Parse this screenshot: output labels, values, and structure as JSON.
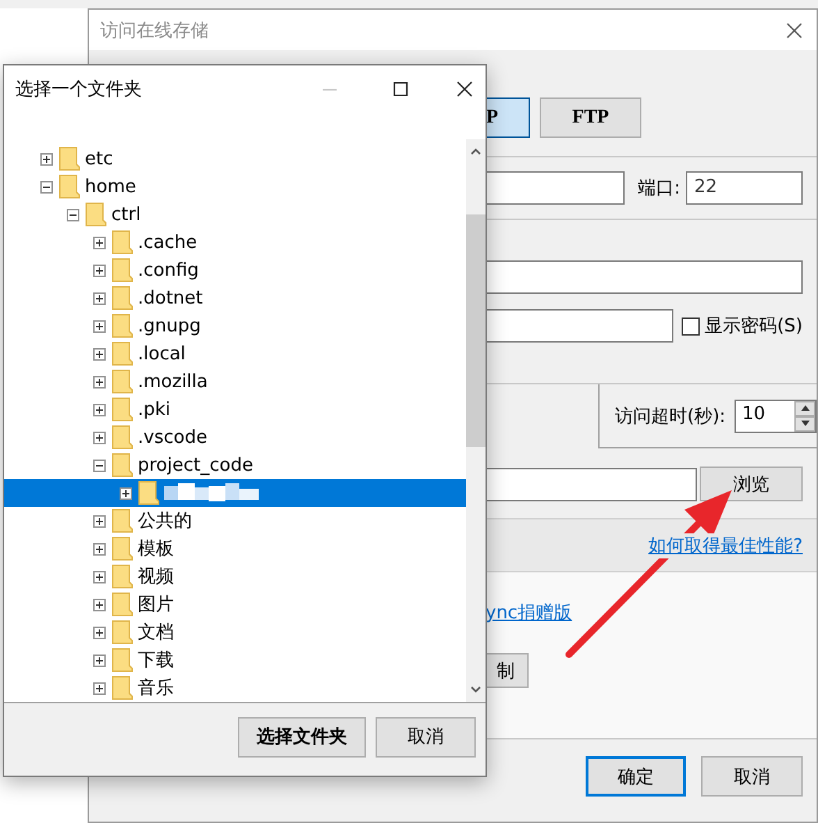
{
  "main_dialog": {
    "title": "访问在线存储",
    "protocols": [
      {
        "label": "P",
        "selected": true
      },
      {
        "label": "FTP",
        "selected": false
      }
    ],
    "port_label": "端口:",
    "port": "22",
    "show_password": {
      "label": "显示密码(S)",
      "checked": false
    },
    "timeout_label": "访问超时(秒):",
    "timeout": "10",
    "browse_button": "浏览",
    "performance_link": "如何取得最佳性能?",
    "donate_link": "ync捐赠版",
    "limit_button": "制",
    "ok_button": "确定",
    "cancel_button": "取消"
  },
  "folder_dialog": {
    "title": "选择一个文件夹",
    "tree": [
      {
        "label": "etc",
        "expanded": false,
        "selected": false
      },
      {
        "label": "home",
        "expanded": true,
        "selected": false,
        "children": [
          {
            "label": "ctrl",
            "expanded": true,
            "selected": false,
            "children": [
              {
                "label": ".cache",
                "expanded": false,
                "selected": false
              },
              {
                "label": ".config",
                "expanded": false,
                "selected": false
              },
              {
                "label": ".dotnet",
                "expanded": false,
                "selected": false
              },
              {
                "label": ".gnupg",
                "expanded": false,
                "selected": false
              },
              {
                "label": ".local",
                "expanded": false,
                "selected": false
              },
              {
                "label": ".mozilla",
                "expanded": false,
                "selected": false
              },
              {
                "label": ".pki",
                "expanded": false,
                "selected": false
              },
              {
                "label": ".vscode",
                "expanded": false,
                "selected": false
              },
              {
                "label": "project_code",
                "expanded": true,
                "selected": false,
                "children": [
                  {
                    "redacted": true,
                    "expanded": false,
                    "selected": true
                  }
                ]
              },
              {
                "label": "公共的",
                "expanded": false,
                "selected": false
              },
              {
                "label": "模板",
                "expanded": false,
                "selected": false
              },
              {
                "label": "视频",
                "expanded": false,
                "selected": false
              },
              {
                "label": "图片",
                "expanded": false,
                "selected": false
              },
              {
                "label": "文档",
                "expanded": false,
                "selected": false
              },
              {
                "label": "下载",
                "expanded": false,
                "selected": false
              },
              {
                "label": "音乐",
                "expanded": false,
                "selected": false
              }
            ]
          }
        ]
      }
    ],
    "select_button": "选择文件夹",
    "cancel_button": "取消"
  }
}
